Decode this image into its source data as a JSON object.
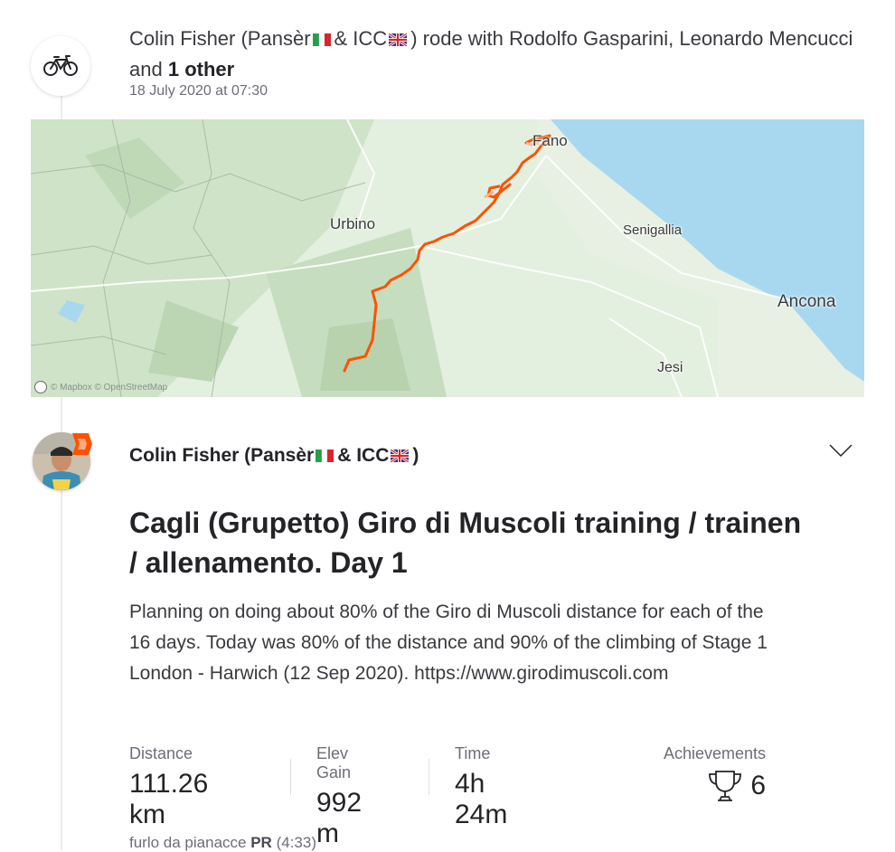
{
  "group": {
    "athlete_name": "Colin Fisher (Pansèr",
    "amp_icc": "& ICC",
    "rode_with": ") rode with Rodolfo Gasparini, Leonardo Mencucci and",
    "others": "1 other",
    "date": "18 July 2020 at 07:30",
    "sport_icon": "bicycle-icon",
    "flags": [
      "italy-flag",
      "uk-flag"
    ]
  },
  "map": {
    "labels": {
      "fano": "Fano",
      "urbino": "Urbino",
      "senigallia": "Senigallia",
      "ancona": "Ancona",
      "jesi": "Jesi"
    },
    "attribution": "© Mapbox © OpenStreetMap",
    "route_color": "#fc5200",
    "sea_color": "#a8d8ef"
  },
  "activity": {
    "athlete_name": "Colin Fisher (Pansèr",
    "amp_icc": "& ICC",
    "close_paren": ")",
    "title": "Cagli (Grupetto) Giro di Muscoli training / trainen / allenamento. Day 1",
    "description": "Planning on doing about 80% of the Giro di Muscoli distance for each of the 16 days. Today was 80% of the distance and 90% of the climbing of Stage 1 London - Harwich (12 Sep 2020). https://www.girodimuscoli.com",
    "stats": {
      "distance_label": "Distance",
      "distance_value": "111.26 km",
      "elev_label": "Elev Gain",
      "elev_value": "992 m",
      "time_label": "Time",
      "time_value": "4h 24m",
      "achievements_label": "Achievements",
      "achievements_value": "6"
    },
    "segment": {
      "name": "furlo da pianacce",
      "pr": "PR",
      "time": "(4:33)"
    }
  }
}
